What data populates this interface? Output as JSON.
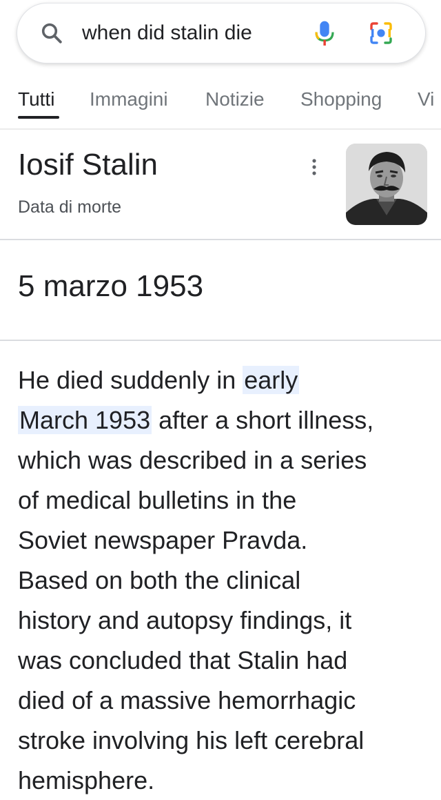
{
  "search": {
    "query": "when did stalin die"
  },
  "tabs": [
    {
      "label": "Tutti",
      "active": true
    },
    {
      "label": "Immagini",
      "active": false
    },
    {
      "label": "Notizie",
      "active": false
    },
    {
      "label": "Shopping",
      "active": false
    },
    {
      "label": "Vi",
      "active": false
    }
  ],
  "entity": {
    "title": "Iosif Stalin",
    "subtitle": "Data di morte",
    "answer": "5 marzo 1953"
  },
  "description": {
    "line1_a": "He died suddenly in ",
    "line1_hl": "early",
    "line2_hl": "March 1953",
    "line2_b": " after a short illness,",
    "line3": "which was described in a series",
    "line4": "of medical bulletins in the",
    "line5": "Soviet newspaper Pravda.",
    "line6": "Based on both the clinical",
    "line7": "history and autopsy findings, it",
    "line8": "was concluded that Stalin had",
    "line9": "died of a massive hemorrhagic",
    "line10": "stroke involving his left cerebral",
    "line11": "hemisphere."
  },
  "colors": {
    "highlight": "#e8f0fe",
    "text": "#202124",
    "secondary_text": "#70757a",
    "google_blue": "#4285f4",
    "google_red": "#ea4335",
    "google_yellow": "#fbbc05",
    "google_green": "#34a853"
  },
  "icons": {
    "search": "search-icon",
    "mic": "mic-icon",
    "lens": "lens-icon",
    "more": "more-vert-icon"
  }
}
